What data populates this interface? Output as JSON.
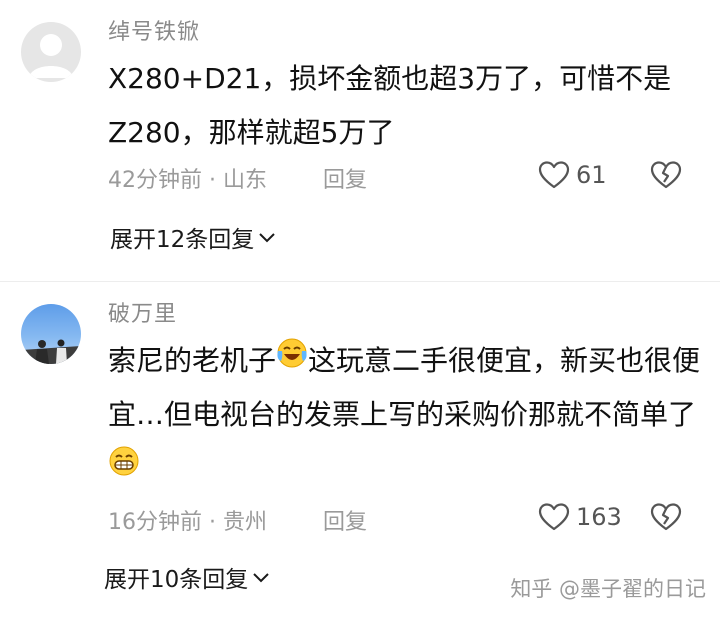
{
  "comments": [
    {
      "username": "绰号铁锨",
      "text": "X280+D21，损坏金额也超3万了，可惜不是Z280，那样就超5万了",
      "time_location": "42分钟前 · 山东",
      "reply_label": "回复",
      "likes": "61",
      "expand_label": "展开12条回复"
    },
    {
      "username": "破万里",
      "text_part1": "索尼的老机子",
      "emoji1": "laughing-crying-emoji",
      "text_part2": "这玩意二手很便宜，新买也很便宜…但电视台的发票上写的采购价那就不简单了",
      "emoji2": "grinning-emoji",
      "time_location": "16分钟前 · 贵州",
      "reply_label": "回复",
      "likes": "163",
      "expand_label": "展开10条回复"
    }
  ],
  "watermark": "知乎 @墨子翟的日记",
  "icons": [
    "default-avatar-icon",
    "heart-icon",
    "broken-heart-icon",
    "chevron-down-icon"
  ]
}
